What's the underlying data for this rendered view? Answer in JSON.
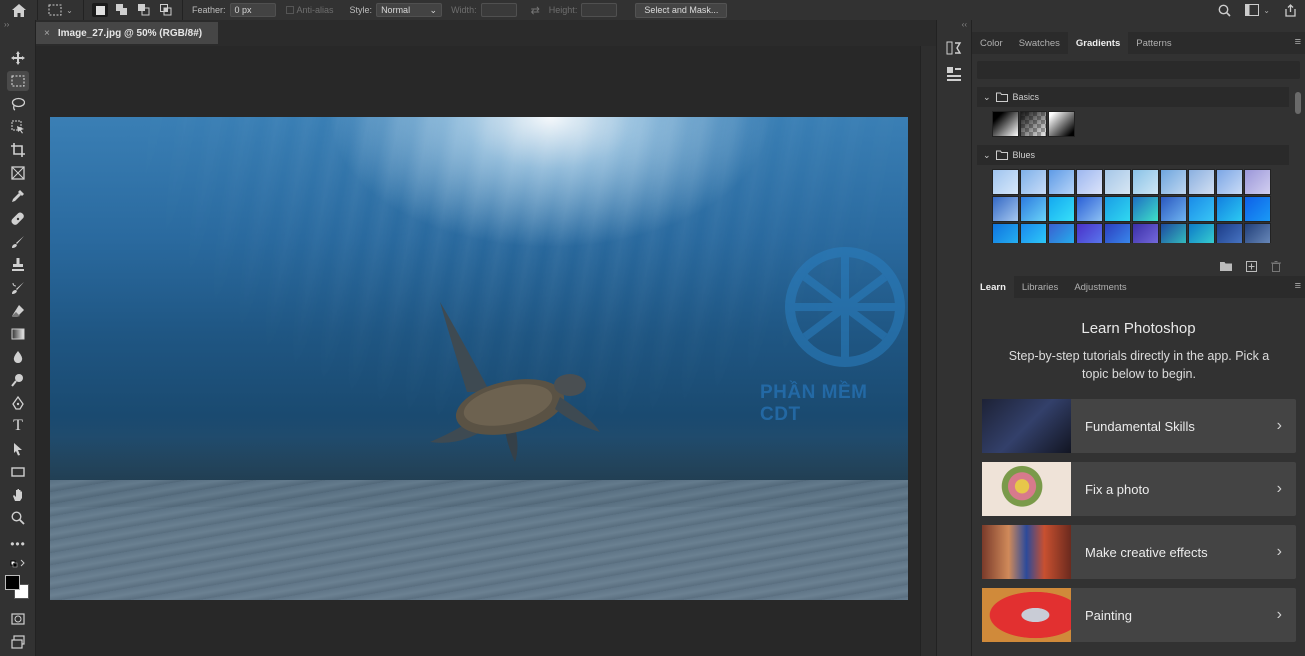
{
  "options_bar": {
    "feather_label": "Feather:",
    "feather_value": "0 px",
    "antialias_label": "Anti-alias",
    "style_label": "Style:",
    "style_value": "Normal",
    "width_label": "Width:",
    "height_label": "Height:",
    "select_mask_label": "Select and Mask..."
  },
  "document": {
    "tab_title": "Image_27.jpg @ 50% (RGB/8#)",
    "close_glyph": "×"
  },
  "watermark": {
    "text": "PHẦN MỀM CDT"
  },
  "gradients_panel": {
    "tabs": [
      "Color",
      "Swatches",
      "Gradients",
      "Patterns"
    ],
    "active_tab": "Gradients",
    "folders": [
      {
        "name": "Basics"
      },
      {
        "name": "Blues"
      }
    ]
  },
  "learn_panel": {
    "tabs": [
      "Learn",
      "Libraries",
      "Adjustments"
    ],
    "active_tab": "Learn",
    "title": "Learn Photoshop",
    "subtitle": "Step-by-step tutorials directly in the app. Pick a topic below to begin.",
    "cards": [
      {
        "title": "Fundamental Skills"
      },
      {
        "title": "Fix a photo"
      },
      {
        "title": "Make creative effects"
      },
      {
        "title": "Painting"
      }
    ]
  },
  "colors": {
    "accent_bg": "#323232",
    "panel_dark": "#2b2b2b",
    "card_bg": "#444444"
  }
}
